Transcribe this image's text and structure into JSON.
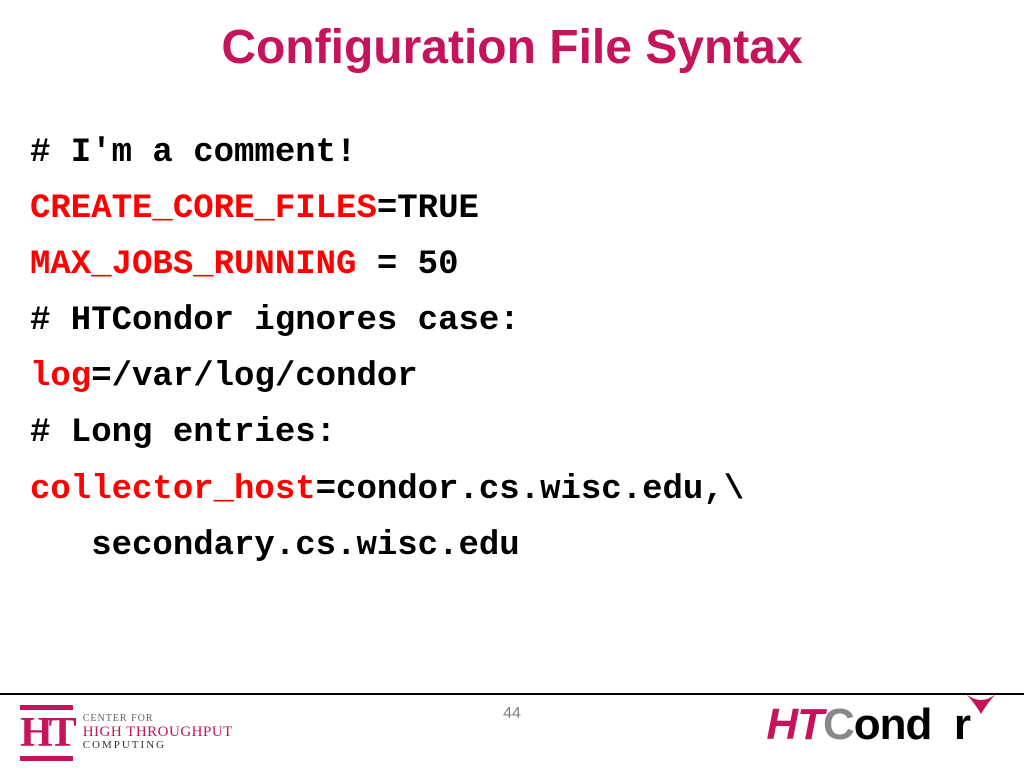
{
  "title": "Configuration File Syntax",
  "lines": {
    "l1": "# I'm a comment!",
    "l2_key": "CREATE_CORE_FILES",
    "l2_rest": "=TRUE",
    "l3_key": "MAX_JOBS_RUNNING",
    "l3_rest": " = 50",
    "l4": "# HTCondor ignores case:",
    "l5_key": "log",
    "l5_rest": "=/var/log/condor",
    "l6": "# Long entries:",
    "l7_key": "collector_host",
    "l7_rest": "=condor.cs.wisc.edu,\\",
    "l8": "   secondary.cs.wisc.edu"
  },
  "page_number": "44",
  "left_logo": {
    "mark": "HT",
    "line1": "CENTER FOR",
    "line2": "HIGH THROUGHPUT",
    "line3": "COMPUTING"
  },
  "right_logo": {
    "ht": "HT",
    "c": "C",
    "ondor": "ond  r"
  }
}
